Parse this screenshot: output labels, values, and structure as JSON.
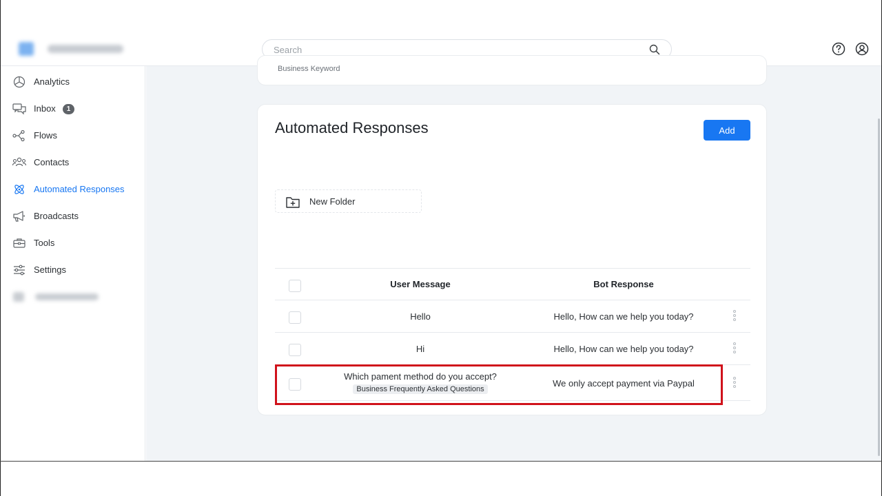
{
  "header": {
    "search_placeholder": "Search",
    "icons": [
      "search-icon",
      "help-icon",
      "account-icon"
    ]
  },
  "sidebar": {
    "items": [
      {
        "label": "Analytics",
        "icon": "pie-chart-icon"
      },
      {
        "label": "Inbox",
        "icon": "chat-bubbles-icon",
        "badge": "1"
      },
      {
        "label": "Flows",
        "icon": "flow-icon"
      },
      {
        "label": "Contacts",
        "icon": "contacts-icon"
      },
      {
        "label": "Automated Responses",
        "icon": "atom-icon",
        "active": true
      },
      {
        "label": "Broadcasts",
        "icon": "megaphone-icon"
      },
      {
        "label": "Tools",
        "icon": "toolbox-icon"
      },
      {
        "label": "Settings",
        "icon": "sliders-icon"
      }
    ],
    "accent_color": "#1877f2"
  },
  "top_card": {
    "keyword_label": "Business Keyword"
  },
  "main": {
    "title": "Automated Responses",
    "add_label": "Add",
    "new_folder_label": "New Folder",
    "table": {
      "headers": {
        "user": "User Message",
        "bot": "Bot Response"
      },
      "rows": [
        {
          "user": "Hello",
          "bot": "Hello, How can we help you today?"
        },
        {
          "user": "Hi",
          "bot": "Hello, How can we help you today?"
        },
        {
          "user": "Which pament method do you accept?",
          "tag": "Business Frequently Asked Questions",
          "bot": "We only accept payment via Paypal",
          "highlighted": true
        }
      ]
    }
  },
  "colors": {
    "primary": "#1877f2",
    "highlight": "#d0121b",
    "background": "#f1f4f7"
  }
}
